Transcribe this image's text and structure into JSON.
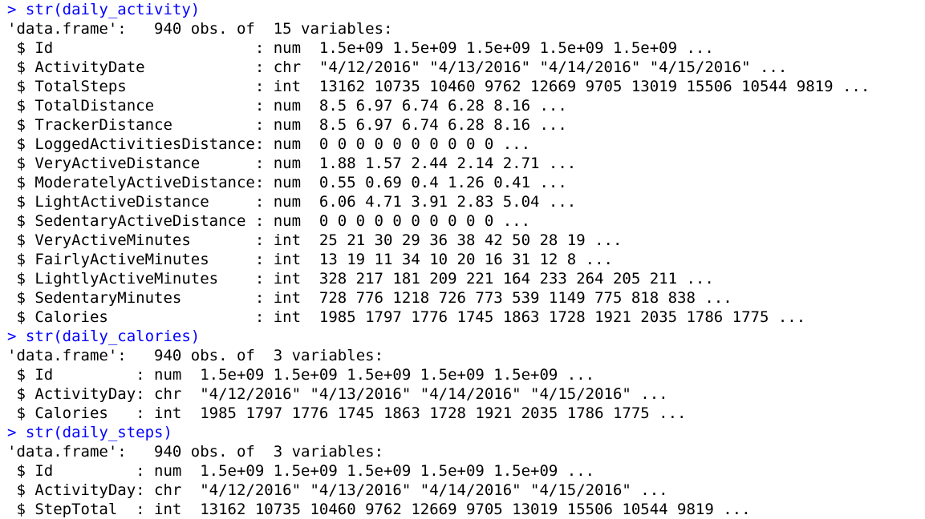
{
  "console": {
    "lines": [
      {
        "kind": "cmd",
        "text": "> str(daily_activity)"
      },
      {
        "kind": "out",
        "text": "'data.frame':\t940 obs. of  15 variables:"
      },
      {
        "kind": "out",
        "text": " $ Id                      : num  1.5e+09 1.5e+09 1.5e+09 1.5e+09 1.5e+09 ..."
      },
      {
        "kind": "out",
        "text": " $ ActivityDate            : chr  \"4/12/2016\" \"4/13/2016\" \"4/14/2016\" \"4/15/2016\" ..."
      },
      {
        "kind": "out",
        "text": " $ TotalSteps              : int  13162 10735 10460 9762 12669 9705 13019 15506 10544 9819 ..."
      },
      {
        "kind": "out",
        "text": " $ TotalDistance           : num  8.5 6.97 6.74 6.28 8.16 ..."
      },
      {
        "kind": "out",
        "text": " $ TrackerDistance         : num  8.5 6.97 6.74 6.28 8.16 ..."
      },
      {
        "kind": "out",
        "text": " $ LoggedActivitiesDistance: num  0 0 0 0 0 0 0 0 0 0 ..."
      },
      {
        "kind": "out",
        "text": " $ VeryActiveDistance      : num  1.88 1.57 2.44 2.14 2.71 ..."
      },
      {
        "kind": "out",
        "text": " $ ModeratelyActiveDistance: num  0.55 0.69 0.4 1.26 0.41 ..."
      },
      {
        "kind": "out",
        "text": " $ LightActiveDistance     : num  6.06 4.71 3.91 2.83 5.04 ..."
      },
      {
        "kind": "out",
        "text": " $ SedentaryActiveDistance : num  0 0 0 0 0 0 0 0 0 0 ..."
      },
      {
        "kind": "out",
        "text": " $ VeryActiveMinutes       : int  25 21 30 29 36 38 42 50 28 19 ..."
      },
      {
        "kind": "out",
        "text": " $ FairlyActiveMinutes     : int  13 19 11 34 10 20 16 31 12 8 ..."
      },
      {
        "kind": "out",
        "text": " $ LightlyActiveMinutes    : int  328 217 181 209 221 164 233 264 205 211 ..."
      },
      {
        "kind": "out",
        "text": " $ SedentaryMinutes        : int  728 776 1218 726 773 539 1149 775 818 838 ..."
      },
      {
        "kind": "out",
        "text": " $ Calories                : int  1985 1797 1776 1745 1863 1728 1921 2035 1786 1775 ..."
      },
      {
        "kind": "cmd",
        "text": "> str(daily_calories)"
      },
      {
        "kind": "out",
        "text": "'data.frame':\t940 obs. of  3 variables:"
      },
      {
        "kind": "out",
        "text": " $ Id         : num  1.5e+09 1.5e+09 1.5e+09 1.5e+09 1.5e+09 ..."
      },
      {
        "kind": "out",
        "text": " $ ActivityDay: chr  \"4/12/2016\" \"4/13/2016\" \"4/14/2016\" \"4/15/2016\" ..."
      },
      {
        "kind": "out",
        "text": " $ Calories   : int  1985 1797 1776 1745 1863 1728 1921 2035 1786 1775 ..."
      },
      {
        "kind": "cmd",
        "text": "> str(daily_steps)"
      },
      {
        "kind": "out",
        "text": "'data.frame':\t940 obs. of  3 variables:"
      },
      {
        "kind": "out",
        "text": " $ Id         : num  1.5e+09 1.5e+09 1.5e+09 1.5e+09 1.5e+09 ..."
      },
      {
        "kind": "out",
        "text": " $ ActivityDay: chr  \"4/12/2016\" \"4/13/2016\" \"4/14/2016\" \"4/15/2016\" ..."
      },
      {
        "kind": "out",
        "text": " $ StepTotal  : int  13162 10735 10460 9762 12669 9705 13019 15506 10544 9819 ..."
      }
    ]
  }
}
